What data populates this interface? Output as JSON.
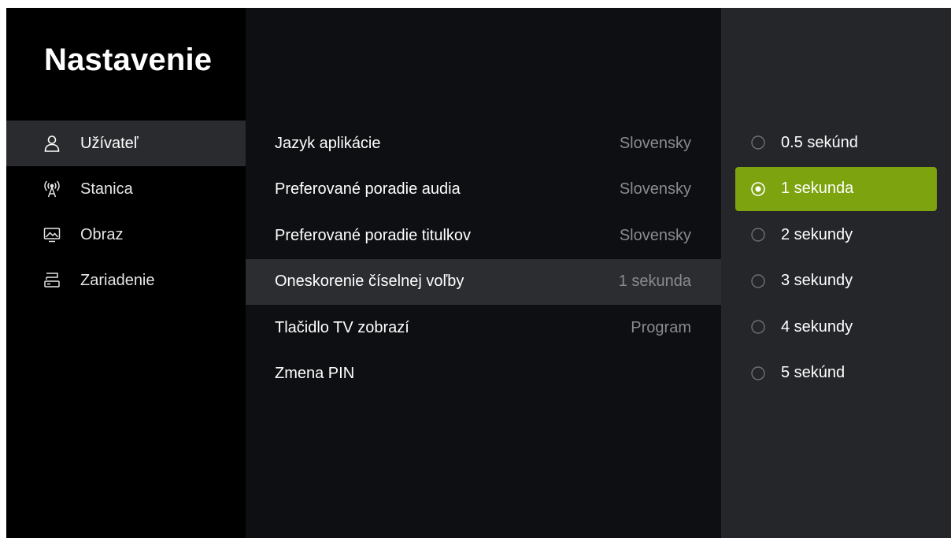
{
  "sidebar": {
    "title": "Nastavenie",
    "items": [
      {
        "label": "Užívateľ",
        "icon": "user-icon",
        "active": true
      },
      {
        "label": "Stanica",
        "icon": "antenna-icon",
        "active": false
      },
      {
        "label": "Obraz",
        "icon": "display-icon",
        "active": false
      },
      {
        "label": "Zariadenie",
        "icon": "device-icon",
        "active": false
      }
    ]
  },
  "settings": {
    "rows": [
      {
        "label": "Jazyk aplikácie",
        "value": "Slovensky"
      },
      {
        "label": "Preferované poradie audia",
        "value": "Slovensky"
      },
      {
        "label": "Preferované poradie titulkov",
        "value": "Slovensky"
      },
      {
        "label": "Oneskorenie číselnej voľby",
        "value": "1 sekunda"
      },
      {
        "label": "Tlačidlo TV zobrazí",
        "value": "Program"
      },
      {
        "label": "Zmena PIN",
        "value": ""
      }
    ],
    "active_index": 3
  },
  "options": {
    "items": [
      {
        "label": "0.5 sekúnd"
      },
      {
        "label": "1 sekunda"
      },
      {
        "label": "2 sekundy"
      },
      {
        "label": "3 sekundy"
      },
      {
        "label": "4 sekundy"
      },
      {
        "label": "5 sekúnd"
      }
    ],
    "selected_index": 1
  },
  "colors": {
    "accent": "#7da30f",
    "sidebar_bg": "#000000",
    "middle_bg": "#0e0f12",
    "options_bg": "#24262a",
    "active_row_bg": "#2c2d31",
    "muted_text": "#8a8b8e"
  }
}
